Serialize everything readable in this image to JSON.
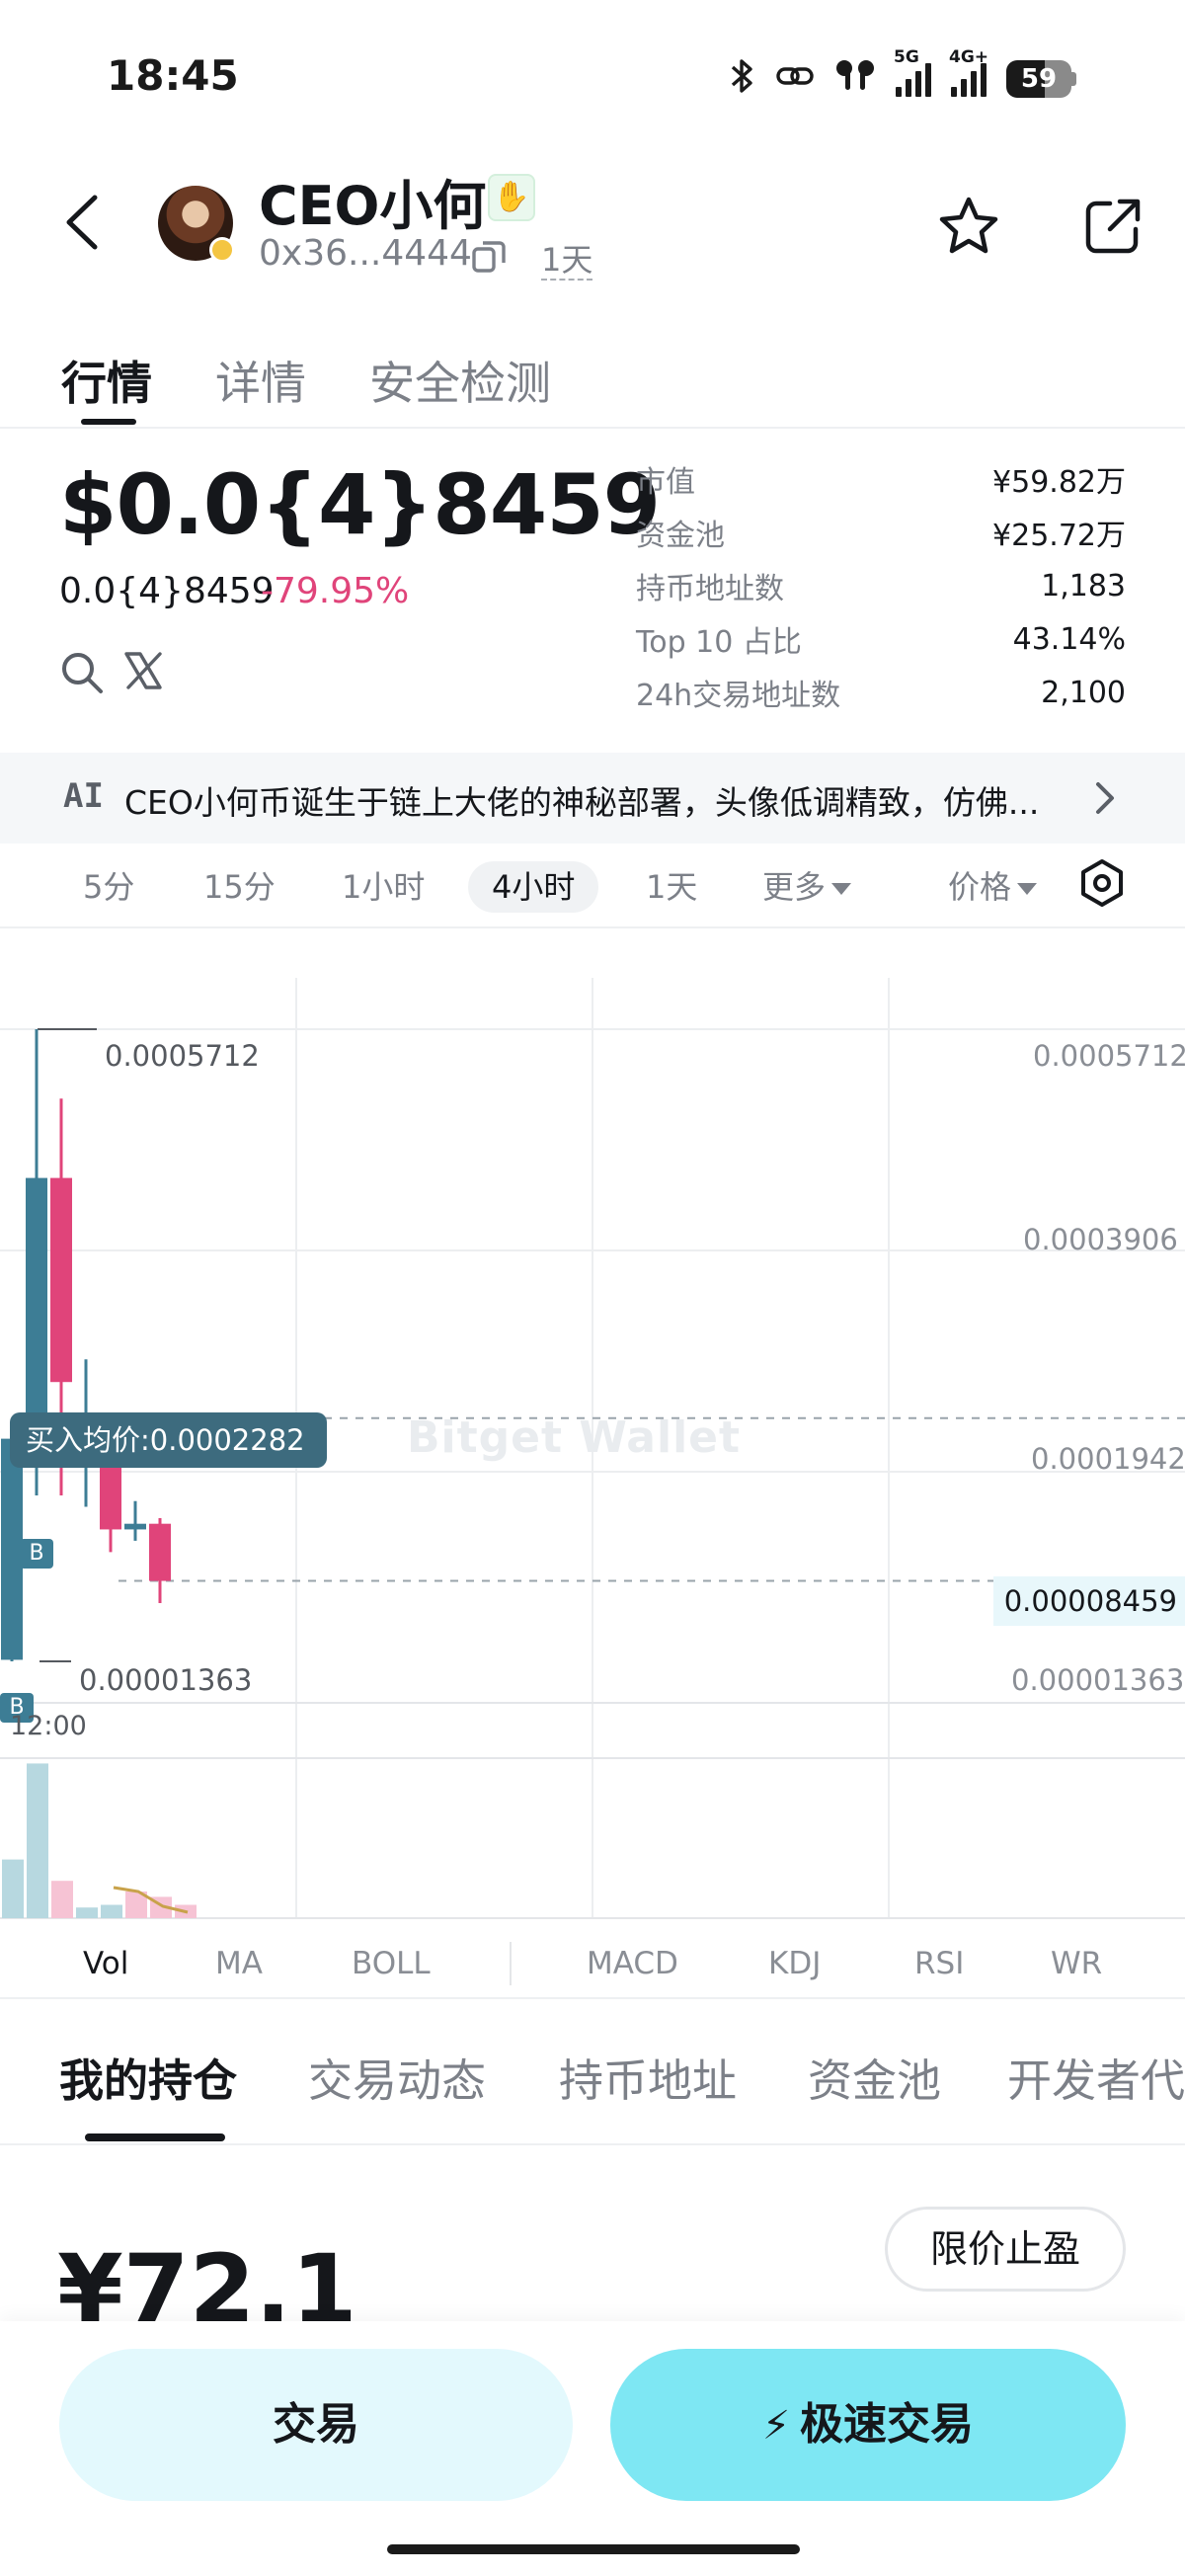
{
  "status_bar": {
    "time": "18:45",
    "network_1": "5G",
    "network_2": "4G+",
    "battery": "59",
    "battery_level": 0.59
  },
  "header": {
    "token_name": "CEO小何",
    "address": "0x36...4444",
    "age": "1天"
  },
  "main_tabs": [
    "行情",
    "详情",
    "安全检测"
  ],
  "price": {
    "main": "$0.0{4}8459",
    "sub": "0.0{4}8459",
    "change": "-79.95%",
    "change_color": "#e0447a"
  },
  "stats": [
    {
      "label": "市值",
      "value": "¥59.82万"
    },
    {
      "label": "资金池",
      "value": "¥25.72万"
    },
    {
      "label": "持币地址数",
      "value": "1,183"
    },
    {
      "label": "Top 10 占比",
      "value": "43.14%"
    },
    {
      "label": "24h交易地址数",
      "value": "2,100"
    }
  ],
  "ai_banner": {
    "tag": "AI",
    "text": "CEO小何币诞生于链上大佬的神秘部署，头像低调精致，仿佛..."
  },
  "intervals": [
    "5分",
    "15分",
    "1小时",
    "4小时",
    "1天",
    "更多",
    "价格"
  ],
  "active_interval": "4小时",
  "chart": {
    "y_labels_right": [
      "0.0005712",
      "0.0003906",
      "0.0001942",
      "0.00001363"
    ],
    "high_label": "0.0005712",
    "low_label": "0.00001363",
    "last_price": "0.00008459",
    "avg_buy_label": "买入均价:0.0002282",
    "b_marker": "B",
    "time_label": "12:00",
    "watermark": "Bitget Wallet",
    "up_color": "#3d7d95",
    "down_color": "#e0447a"
  },
  "chart_data": {
    "type": "candlestick",
    "ylim": [
      1.363e-05,
      0.0005712
    ],
    "candles": [
      {
        "open": 1.5e-05,
        "high": 0.00021,
        "low": 1.363e-05,
        "close": 0.00021
      },
      {
        "open": 0.00021,
        "high": 0.0005712,
        "low": 0.00016,
        "close": 0.00044
      },
      {
        "open": 0.00044,
        "high": 0.00051,
        "low": 0.00016,
        "close": 0.00026
      },
      {
        "open": 0.00022,
        "high": 0.00028,
        "low": 0.00015,
        "close": 0.00022
      },
      {
        "open": 0.00021,
        "high": 0.00023,
        "low": 0.00011,
        "close": 0.00013
      },
      {
        "open": 0.00013,
        "high": 0.000155,
        "low": 0.00012,
        "close": 0.000135
      },
      {
        "open": 0.000135,
        "high": 0.00014,
        "low": 6.5e-05,
        "close": 8.459e-05
      }
    ],
    "reference_lines": [
      {
        "label": "买入均价:0.0002282",
        "value": 0.0002282
      },
      {
        "label": "0.00008459",
        "value": 8.459e-05
      }
    ],
    "volume": [
      0.22,
      0.58,
      0.14,
      0.04,
      0.05,
      0.1,
      0.08,
      0.05
    ]
  },
  "indicators": [
    "Vol",
    "MA",
    "BOLL",
    "MACD",
    "KDJ",
    "RSI",
    "WR"
  ],
  "bottom_tabs": [
    "我的持仓",
    "交易动态",
    "持币地址",
    "资金池",
    "开发者代"
  ],
  "holding": {
    "value": "¥72.1",
    "limit_button": "限价止盈"
  },
  "actions": {
    "trade": "交易",
    "fast_trade": "极速交易"
  }
}
